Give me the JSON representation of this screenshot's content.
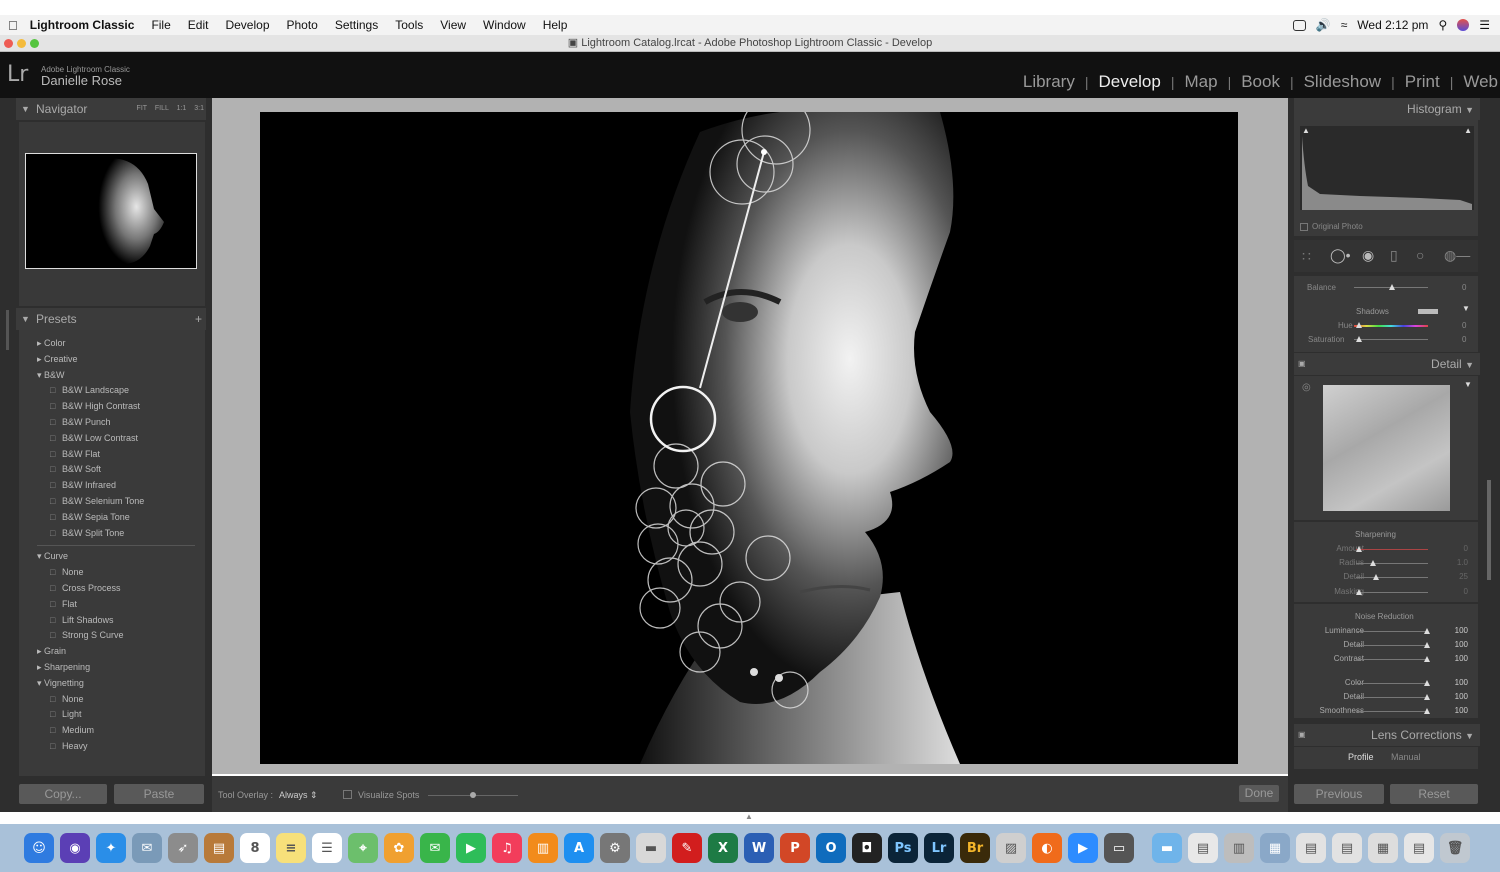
{
  "menubar": {
    "app_name": "Lightroom Classic",
    "items": [
      "File",
      "Edit",
      "Develop",
      "Photo",
      "Settings",
      "Tools",
      "View",
      "Window",
      "Help"
    ],
    "datetime": "Wed 2:12 pm"
  },
  "window": {
    "title": "Lightroom Catalog.lrcat - Adobe Photoshop Lightroom Classic - Develop"
  },
  "identity": {
    "logo": "Lr",
    "small": "Adobe Lightroom Classic",
    "name": "Danielle Rose"
  },
  "modules": [
    "Library",
    "Develop",
    "Map",
    "Book",
    "Slideshow",
    "Print",
    "Web"
  ],
  "active_module": "Develop",
  "navigator": {
    "title": "Navigator",
    "zoom_options": [
      "FIT",
      "FILL",
      "1:1",
      "3:1"
    ]
  },
  "presets": {
    "title": "Presets",
    "add_symbol": "+",
    "groups": [
      {
        "label": "Color",
        "open": false,
        "items": []
      },
      {
        "label": "Creative",
        "open": false,
        "items": []
      },
      {
        "label": "B&W",
        "open": true,
        "items": [
          "B&W Landscape",
          "B&W High Contrast",
          "B&W Punch",
          "B&W Low Contrast",
          "B&W Flat",
          "B&W Soft",
          "B&W Infrared",
          "B&W Selenium Tone",
          "B&W Sepia Tone",
          "B&W Split Tone"
        ]
      },
      {
        "label": "Curve",
        "open": true,
        "items": [
          "None",
          "Cross Process",
          "Flat",
          "Lift Shadows",
          "Strong S Curve"
        ]
      },
      {
        "label": "Grain",
        "open": false,
        "items": []
      },
      {
        "label": "Sharpening",
        "open": false,
        "items": []
      },
      {
        "label": "Vignetting",
        "open": true,
        "items": [
          "None",
          "Light",
          "Medium",
          "Heavy"
        ]
      }
    ]
  },
  "left_buttons": {
    "copy": "Copy...",
    "paste": "Paste"
  },
  "toolbar": {
    "overlay_label": "Tool Overlay :",
    "overlay_value": "Always",
    "visualize_label": "Visualize Spots",
    "done": "Done"
  },
  "histogram": {
    "title": "Histogram",
    "original_photo": "Original Photo"
  },
  "split_toning": {
    "balance_label": "Balance",
    "balance_value": "0",
    "shadows_label": "Shadows",
    "hue_label": "Hue",
    "hue_value": "0",
    "saturation_label": "Saturation",
    "saturation_value": "0"
  },
  "detail": {
    "title": "Detail",
    "sharpening_title": "Sharpening",
    "sharpening": [
      {
        "label": "Amount",
        "value": "0"
      },
      {
        "label": "Radius",
        "value": "1.0"
      },
      {
        "label": "Detail",
        "value": "25"
      },
      {
        "label": "Masking",
        "value": "0"
      }
    ],
    "noise_title": "Noise Reduction",
    "noise": [
      {
        "label": "Luminance",
        "value": "100"
      },
      {
        "label": "Detail",
        "value": "100"
      },
      {
        "label": "Contrast",
        "value": "100"
      },
      {
        "label": "Color",
        "value": "100"
      },
      {
        "label": "Detail",
        "value": "100"
      },
      {
        "label": "Smoothness",
        "value": "100"
      }
    ]
  },
  "lens": {
    "title": "Lens Corrections",
    "tabs": [
      "Profile",
      "Manual"
    ]
  },
  "right_buttons": {
    "previous": "Previous",
    "reset": "Reset"
  },
  "dock": {
    "items": [
      {
        "name": "finder",
        "color": "#2f7be0",
        "glyph": "☺"
      },
      {
        "name": "siri",
        "color": "#5b3fb5",
        "glyph": "◉"
      },
      {
        "name": "safari",
        "color": "#2a8ee8",
        "glyph": "✦"
      },
      {
        "name": "mail-stamp",
        "color": "#7a9ab8",
        "glyph": "✉"
      },
      {
        "name": "launchpad",
        "color": "#8c8c8c",
        "glyph": "➶"
      },
      {
        "name": "notes-brown",
        "color": "#b87a3a",
        "glyph": "▤"
      },
      {
        "name": "calendar",
        "color": "#ffffff",
        "glyph": "8"
      },
      {
        "name": "notes",
        "color": "#f7e07a",
        "glyph": "≡"
      },
      {
        "name": "reminders",
        "color": "#ffffff",
        "glyph": "☰"
      },
      {
        "name": "maps",
        "color": "#6cbf6c",
        "glyph": "⌖"
      },
      {
        "name": "photos",
        "color": "#f0a030",
        "glyph": "✿"
      },
      {
        "name": "messages",
        "color": "#39b54a",
        "glyph": "✉"
      },
      {
        "name": "facetime",
        "color": "#2ebd59",
        "glyph": "▶"
      },
      {
        "name": "music",
        "color": "#f23d5b",
        "glyph": "♫"
      },
      {
        "name": "books",
        "color": "#f28b1b",
        "glyph": "▥"
      },
      {
        "name": "app-store",
        "color": "#1e8ff0",
        "glyph": "A"
      },
      {
        "name": "system-preferences",
        "color": "#777777",
        "glyph": "⚙"
      },
      {
        "name": "printer",
        "color": "#d8d8d8",
        "glyph": "▬"
      },
      {
        "name": "acrobat",
        "color": "#d21e1e",
        "glyph": "✎"
      },
      {
        "name": "excel",
        "color": "#1e7b45",
        "glyph": "X"
      },
      {
        "name": "word",
        "color": "#2b5fb4",
        "glyph": "W"
      },
      {
        "name": "powerpoint",
        "color": "#d24726",
        "glyph": "P"
      },
      {
        "name": "outlook",
        "color": "#0f6cbd",
        "glyph": "O"
      },
      {
        "name": "camera",
        "color": "#222222",
        "glyph": "◘"
      },
      {
        "name": "photoshop",
        "color": "#0b2438",
        "glyph": "Ps"
      },
      {
        "name": "lightroom-classic",
        "color": "#0b2438",
        "glyph": "Lr"
      },
      {
        "name": "bridge",
        "color": "#3a2a0a",
        "glyph": "Br"
      },
      {
        "name": "preview",
        "color": "#cfcfcf",
        "glyph": "▨"
      },
      {
        "name": "firefox",
        "color": "#f06b1b",
        "glyph": "◐"
      },
      {
        "name": "zoom",
        "color": "#2d8cff",
        "glyph": "▶"
      },
      {
        "name": "scanner",
        "color": "#555555",
        "glyph": "▭"
      },
      {
        "name": "folder",
        "color": "#6fb4ea",
        "glyph": "▬"
      },
      {
        "name": "doc1",
        "color": "#e8e8e8",
        "glyph": "▤"
      },
      {
        "name": "doc2",
        "color": "#bdbdbd",
        "glyph": "▥"
      },
      {
        "name": "doc3",
        "color": "#8aa8c8",
        "glyph": "▦"
      },
      {
        "name": "doc4",
        "color": "#e2e2e2",
        "glyph": "▤"
      },
      {
        "name": "doc5",
        "color": "#e2e2e2",
        "glyph": "▤"
      },
      {
        "name": "doc6",
        "color": "#dddddd",
        "glyph": "▦"
      },
      {
        "name": "doc7",
        "color": "#e6e6e6",
        "glyph": "▤"
      },
      {
        "name": "trash",
        "color": "#c0c8d0",
        "glyph": "🗑"
      }
    ]
  }
}
